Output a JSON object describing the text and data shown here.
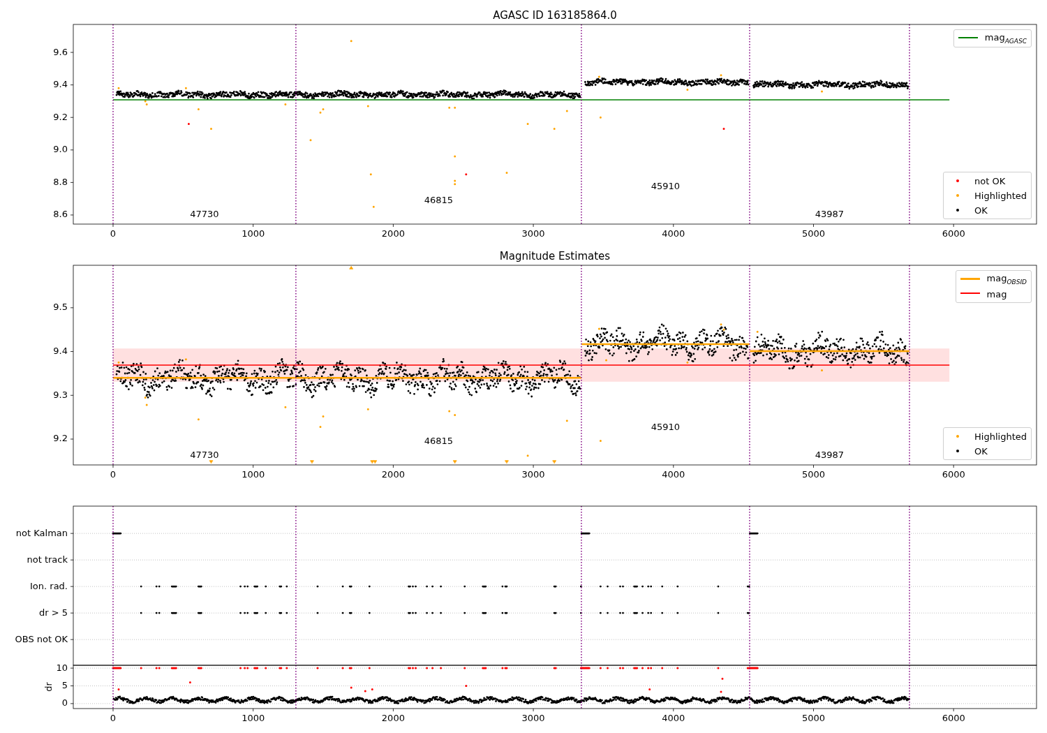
{
  "figure": {
    "panels": [
      {
        "kind": "magnitude",
        "chart_data": {
          "type": "line",
          "title": "AGASC ID 163185864.0",
          "xlim": [
            -284,
            6592
          ],
          "ylim": [
            8.544,
            9.772
          ],
          "xticks": [
            0,
            1000,
            2000,
            3000,
            4000,
            5000,
            6000
          ],
          "yticks": [
            {
              "value": 8.6,
              "label": "8.6"
            },
            {
              "value": 8.8,
              "label": "8.8"
            },
            {
              "value": 9.0,
              "label": "9.0"
            },
            {
              "value": 9.2,
              "label": "9.2"
            },
            {
              "value": 9.4,
              "label": "9.4"
            },
            {
              "value": 9.6,
              "label": "9.6"
            }
          ],
          "x": [
            0,
            5970
          ],
          "series": [
            {
              "name": "mag$_{AGASC}$",
              "color": "#008000",
              "values": [
                9.308,
                9.308
              ]
            }
          ],
          "ref_lines": [
            {
              "axis": "x",
              "value": 0,
              "color": "#800080"
            },
            {
              "axis": "x",
              "value": 1305,
              "color": "#800080"
            },
            {
              "axis": "x",
              "value": 3343,
              "color": "#800080"
            },
            {
              "axis": "x",
              "value": 4544,
              "color": "#800080"
            },
            {
              "axis": "x",
              "value": 5685,
              "color": "#800080"
            }
          ],
          "annotations": [
            "47730",
            "46815",
            "45910",
            "43987"
          ]
        },
        "legends": [
          {
            "entries": [
              {
                "label": "not OK",
                "kind": "dot",
                "color": "#ff0000"
              },
              {
                "label": "Highlighted",
                "kind": "dot",
                "color": "#ffa500"
              },
              {
                "label": "OK",
                "kind": "dot",
                "color": "#000000"
              }
            ]
          }
        ]
      },
      {
        "kind": "magnitude",
        "chart_data": {
          "type": "line",
          "title": "Magnitude Estimates",
          "xlim": [
            -284,
            6592
          ],
          "ylim": [
            9.141,
            9.597
          ],
          "xticks": [
            0,
            1000,
            2000,
            3000,
            4000,
            5000,
            6000
          ],
          "yticks": [
            {
              "value": 9.2,
              "label": "9.2"
            },
            {
              "value": 9.3,
              "label": "9.3"
            },
            {
              "value": 9.4,
              "label": "9.4"
            },
            {
              "value": 9.5,
              "label": "9.5"
            }
          ],
          "x": [
            0,
            3343,
            3344,
            3345,
            4544,
            4545,
            4546,
            5685,
            5970
          ],
          "series": [
            {
              "name": "mag$_{OBSID}$",
              "color": "#ffa500",
              "values": [
                9.34,
                9.34,
                null,
                9.417,
                9.417,
                null,
                9.401,
                9.401,
                null
              ]
            },
            {
              "name": "mag",
              "color": "#ff0000",
              "values": [
                9.369,
                9.369,
                9.369,
                9.369,
                9.369,
                9.369,
                9.369,
                9.369,
                9.369
              ]
            }
          ],
          "bands": [
            {
              "axis": "y",
              "from": 9.331,
              "to": 9.407,
              "color": "#ff0000"
            }
          ],
          "ref_lines": [
            {
              "axis": "x",
              "value": 0,
              "color": "#800080"
            },
            {
              "axis": "x",
              "value": 1305,
              "color": "#800080"
            },
            {
              "axis": "x",
              "value": 3343,
              "color": "#800080"
            },
            {
              "axis": "x",
              "value": 4544,
              "color": "#800080"
            },
            {
              "axis": "x",
              "value": 5685,
              "color": "#800080"
            }
          ],
          "annotations": [
            "47730",
            "46815",
            "45910",
            "43987"
          ]
        },
        "legends": [
          {
            "entries": [
              {
                "label": "Highlighted",
                "kind": "dot",
                "color": "#ffa500"
              },
              {
                "label": "OK",
                "kind": "dot",
                "color": "#000000"
              }
            ]
          }
        ]
      },
      {
        "kind": "flags",
        "chart_data": {
          "type": "scatter",
          "orientation": "horizontal",
          "grid": true,
          "xlim": [
            -284,
            6592
          ],
          "categories": [
            "not Kalman",
            "not track",
            "Ion. rad.",
            "dr > 5",
            "OBS not OK"
          ],
          "ref_lines": [
            {
              "axis": "x",
              "value": 0,
              "color": "#800080"
            },
            {
              "axis": "x",
              "value": 1305,
              "color": "#800080"
            },
            {
              "axis": "x",
              "value": 3343,
              "color": "#800080"
            },
            {
              "axis": "x",
              "value": 4544,
              "color": "#800080"
            },
            {
              "axis": "x",
              "value": 5685,
              "color": "#800080"
            }
          ]
        }
      },
      {
        "kind": "dr",
        "chart_data": {
          "type": "scatter",
          "ylabel": "dr",
          "grid": true,
          "xlim": [
            -284,
            6592
          ],
          "ylim": [
            -1.4,
            10.8
          ],
          "xticks": [
            0,
            1000,
            2000,
            3000,
            4000,
            5000,
            6000
          ],
          "yticks": [
            0,
            5,
            10
          ],
          "ref_lines": [
            {
              "axis": "x",
              "value": 0,
              "color": "#800080"
            },
            {
              "axis": "x",
              "value": 1305,
              "color": "#800080"
            },
            {
              "axis": "x",
              "value": 3343,
              "color": "#800080"
            },
            {
              "axis": "x",
              "value": 4544,
              "color": "#800080"
            },
            {
              "axis": "x",
              "value": 5685,
              "color": "#800080"
            }
          ]
        }
      }
    ]
  }
}
